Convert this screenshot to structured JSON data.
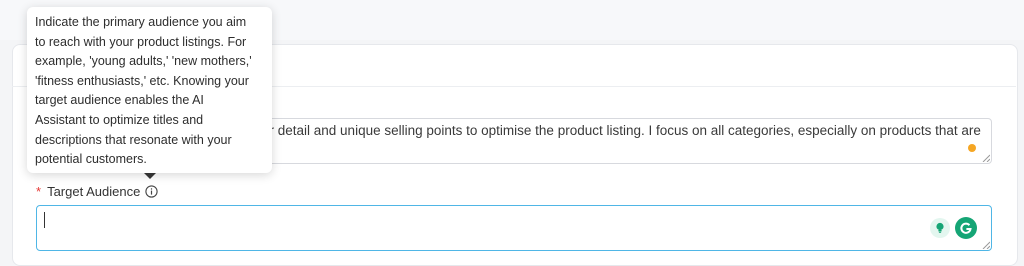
{
  "tooltip": {
    "lines": [
      "Indicate the primary audience you aim",
      "to reach with your product listings. For",
      "example, 'young adults,' 'new mothers,'",
      "'fitness enthusiasts,' etc. Knowing your",
      "target audience enables the AI",
      "Assistant to optimize titles and",
      "descriptions that resonate with your",
      "potential customers."
    ]
  },
  "description_field": {
    "visible_line1": "or detail and unique selling points to optimise the product listing. I focus on all categories, especially on products that are",
    "visible_line2": "."
  },
  "target_audience": {
    "required_mark": "*",
    "label": "Target Audience",
    "value": ""
  },
  "icons": {
    "info": "info-circle-icon",
    "bulb": "lightbulb-icon",
    "grammarly": "grammarly-g-icon",
    "resize": "resize-handle-icon"
  },
  "colors": {
    "focus_border": "#4fb6e6",
    "required": "#e53935",
    "grammarly": "#15a575",
    "notice_dot": "#f5a623"
  }
}
